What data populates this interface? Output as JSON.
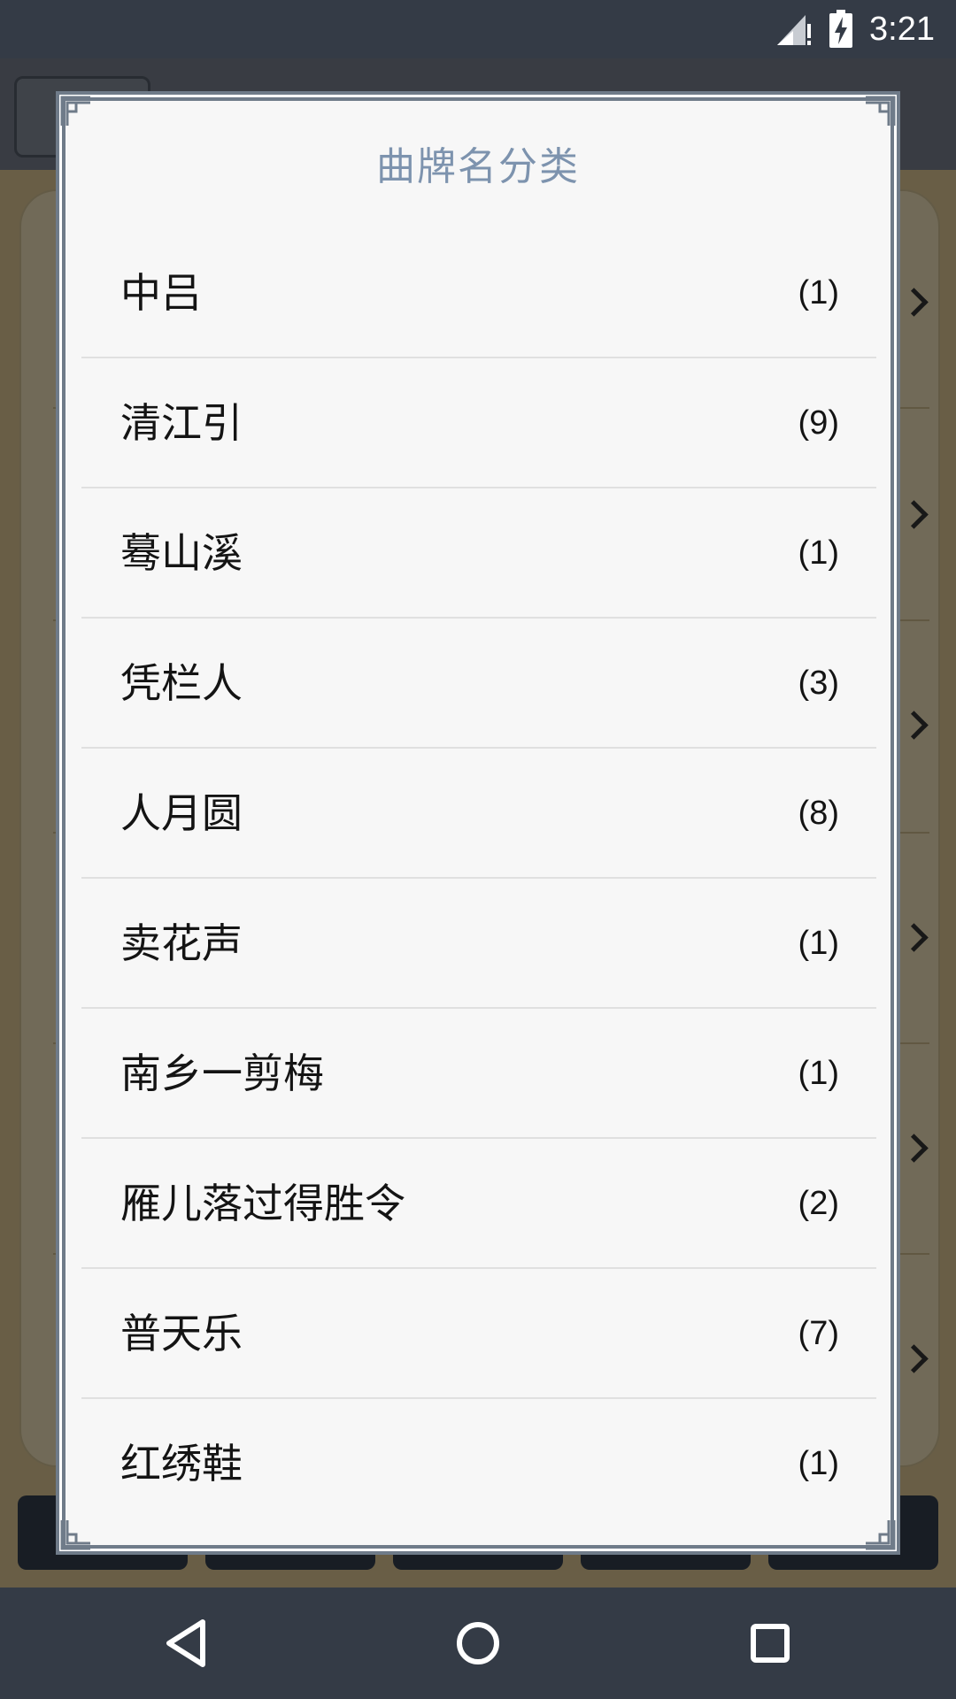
{
  "status_bar": {
    "time": "3:21"
  },
  "dialog": {
    "title": "曲牌名分类",
    "items": [
      {
        "name": "中吕",
        "count": "(1)"
      },
      {
        "name": "清江引",
        "count": "(9)"
      },
      {
        "name": "蓦山溪",
        "count": "(1)"
      },
      {
        "name": "凭栏人",
        "count": "(3)"
      },
      {
        "name": "人月圆",
        "count": "(8)"
      },
      {
        "name": "卖花声",
        "count": "(1)"
      },
      {
        "name": "南乡一剪梅",
        "count": "(1)"
      },
      {
        "name": "雁儿落过得胜令",
        "count": "(2)"
      },
      {
        "name": "普天乐",
        "count": "(7)"
      },
      {
        "name": "红绣鞋",
        "count": "(1)"
      }
    ]
  },
  "icons": {
    "signal": "signal-icon",
    "battery": "battery-charging-icon",
    "back": "back-icon",
    "home": "home-icon",
    "recents": "recents-icon"
  }
}
